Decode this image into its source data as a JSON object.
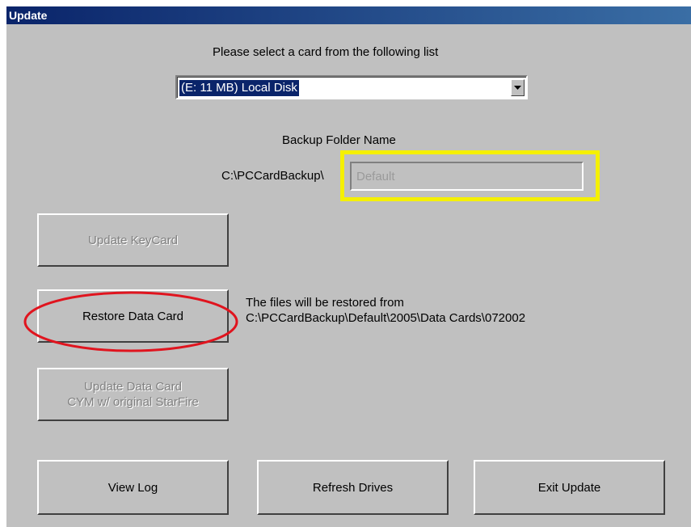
{
  "window": {
    "title": "Update"
  },
  "card_select": {
    "prompt": "Please select a card from the following list",
    "selected": "(E: 11 MB) Local Disk"
  },
  "backup": {
    "heading": "Backup Folder Name",
    "path_prefix": "C:\\PCCardBackup\\",
    "folder_value": "Default"
  },
  "buttons": {
    "update_keycard": "Update KeyCard",
    "restore_data_card": "Restore Data Card",
    "update_data_card": "Update Data Card\nCYM w/ original StarFire",
    "view_log": "View Log",
    "refresh_drives": "Refresh Drives",
    "exit_update": "Exit Update"
  },
  "restore_info": {
    "line1": "The files will be restored from",
    "line2": "C:\\PCCardBackup\\Default\\2005\\Data Cards\\072002"
  },
  "colors": {
    "window_bg": "#c0c0c0",
    "titlebar": "#0a246a",
    "highlight_box": "#f5f000",
    "annotation_circle": "#e0141e"
  }
}
